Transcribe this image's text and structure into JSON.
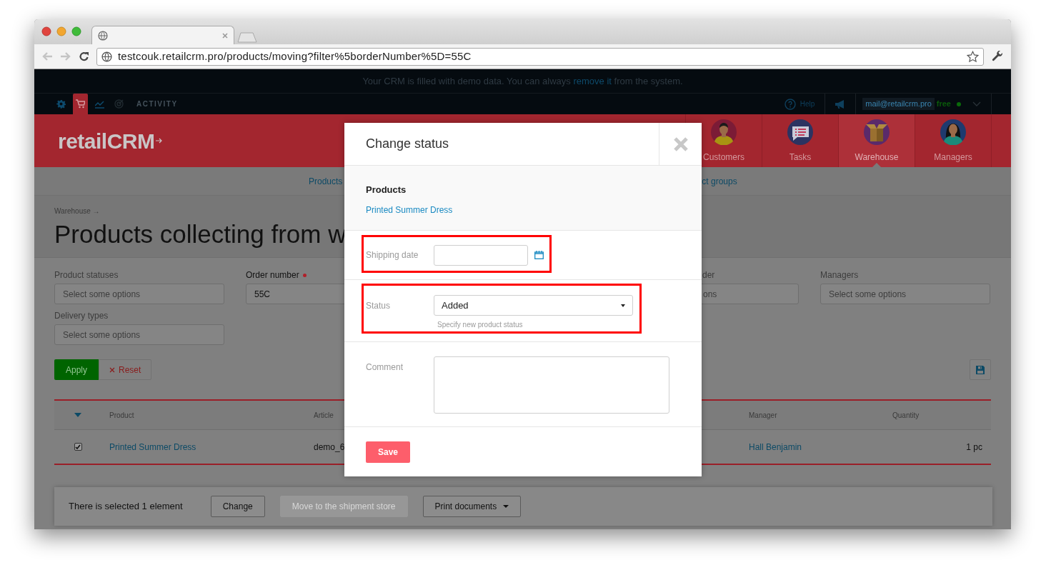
{
  "browser": {
    "url": "testcouk.retailcrm.pro/products/moving?filter%5borderNumber%5D=55C"
  },
  "demo_banner": {
    "before": "Your CRM is filled with demo data. You can always ",
    "link": "remove it",
    "after": " from the system."
  },
  "top_bar": {
    "modules": [
      {
        "kind": "gear",
        "selected": false
      },
      {
        "kind": "cart",
        "selected": true
      },
      {
        "kind": "chart",
        "selected": false
      },
      {
        "kind": "target",
        "selected": false
      }
    ],
    "activity": "ACTIVITY",
    "help": "Help",
    "account": "mail@retailcrm.pro",
    "plan": "free"
  },
  "header": {
    "logo": "retailCRM",
    "nav": [
      {
        "label": "Customers",
        "kind": "man",
        "selected": false
      },
      {
        "label": "Tasks",
        "kind": "tasks",
        "selected": false
      },
      {
        "label": "Warehouse",
        "kind": "box",
        "selected": true
      },
      {
        "label": "Managers",
        "kind": "woman",
        "selected": false
      }
    ]
  },
  "subnav": [
    "Products",
    "ct groups"
  ],
  "breadcrumb": "Warehouse →",
  "title": "Products collecting from w",
  "filters": [
    {
      "kind": "field",
      "label": "Product statuses",
      "placeholder": "Select some options"
    },
    {
      "kind": "field",
      "label": "Order number",
      "value": "55C",
      "required": true
    },
    {
      "kind": "partial",
      "label": "der",
      "placeholder": "ons"
    },
    {
      "kind": "field",
      "label": "Managers",
      "placeholder": "Select some options"
    },
    {
      "kind": "field",
      "label": "Delivery types",
      "placeholder": "Select some options"
    }
  ],
  "filter_buttons": {
    "apply": "Apply",
    "reset": "Reset"
  },
  "table": {
    "columns": [
      "Product",
      "Article",
      "Manager",
      "Quantity"
    ],
    "rows": [
      {
        "checked": true,
        "cells": [
          "Printed Summer Dress",
          "demo_6",
          "Hall Benjamin",
          "1 pc"
        ]
      }
    ]
  },
  "selection_bar": {
    "text": "There is selected 1 element",
    "buttons": [
      {
        "label": "Change",
        "disabled": false,
        "dropdown": false
      },
      {
        "label": "Move to the shipment store",
        "disabled": true,
        "dropdown": false
      },
      {
        "label": "Print documents",
        "disabled": false,
        "dropdown": true
      }
    ]
  },
  "modal": {
    "title": "Change status",
    "products_heading": "Products",
    "products": [
      "Printed Summer Dress"
    ],
    "fields": [
      {
        "kind": "date",
        "label": "Shipping date",
        "highlighted": true
      },
      {
        "kind": "select",
        "label": "Status",
        "value": "Added",
        "hint": "Specify new product status",
        "highlighted": true
      },
      {
        "kind": "textarea",
        "label": "Comment",
        "highlighted": false
      }
    ],
    "save": "Save"
  }
}
